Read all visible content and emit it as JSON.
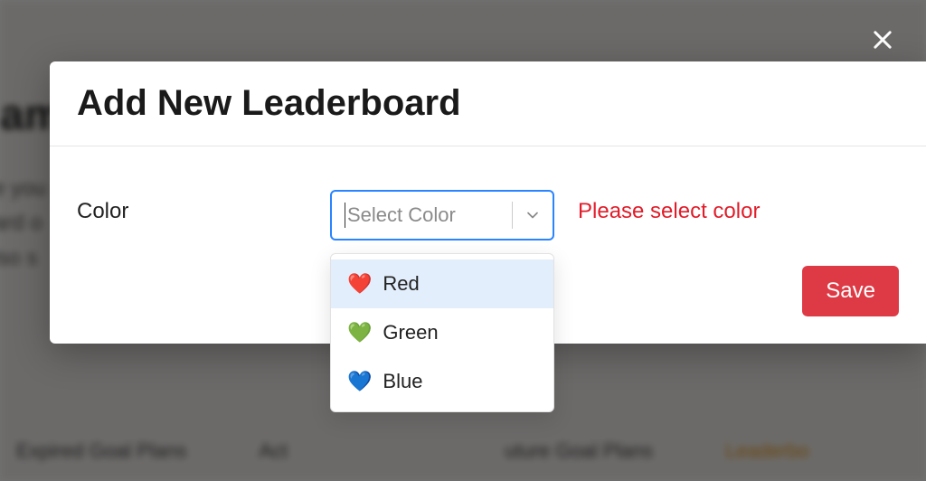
{
  "background": {
    "heading_fragment": "am",
    "paragraph_fragment": "e you\nard o\nlso s",
    "tabs": {
      "expired": "Expired Goal Plans",
      "active_fragment": "Act",
      "future_fragment": "uture Goal Plans",
      "leaderboard_fragment": "Leaderbo"
    }
  },
  "modal": {
    "title": "Add New Leaderboard",
    "color_field": {
      "label": "Color",
      "placeholder": "Select Color",
      "validation_message": "Please select color",
      "options": [
        {
          "icon": "❤️",
          "label": "Red",
          "highlighted": true
        },
        {
          "icon": "💚",
          "label": "Green",
          "highlighted": false
        },
        {
          "icon": "💙",
          "label": "Blue",
          "highlighted": false
        }
      ]
    },
    "save_label": "Save"
  }
}
